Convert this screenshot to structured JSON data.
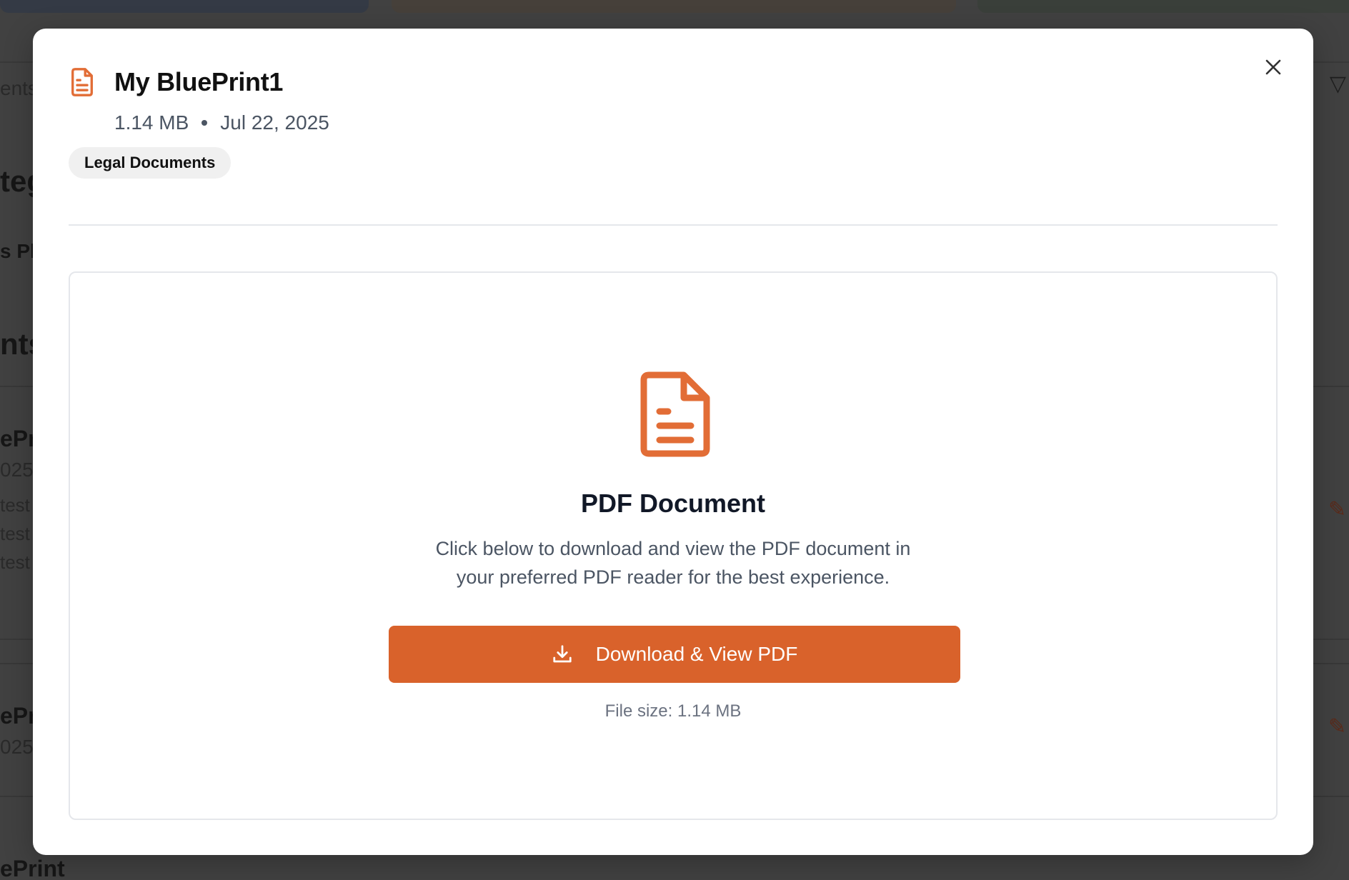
{
  "modal": {
    "title": "My BluePrint1",
    "size": "1.14 MB",
    "date": "Jul 22, 2025",
    "tag": "Legal Documents",
    "close_icon": "close-icon",
    "file_icon": "file-text-icon"
  },
  "viewer": {
    "heading": "PDF Document",
    "description_line1": "Click below to download and view the PDF document in",
    "description_line2": "your preferred PDF reader for the best experience.",
    "download_label": "Download & View PDF",
    "download_icon": "download-icon",
    "file_size": "File size: 1.14 MB"
  },
  "background": {
    "left_texts": [
      "ents",
      "teg",
      "s Pl",
      "nts",
      "ePr",
      "025",
      "test",
      "test",
      "test",
      "ePr",
      "025",
      "ePrint"
    ]
  },
  "colors": {
    "accent": "#d9622b",
    "icon": "#e26d36",
    "tag_bg": "#f0f0f0"
  }
}
